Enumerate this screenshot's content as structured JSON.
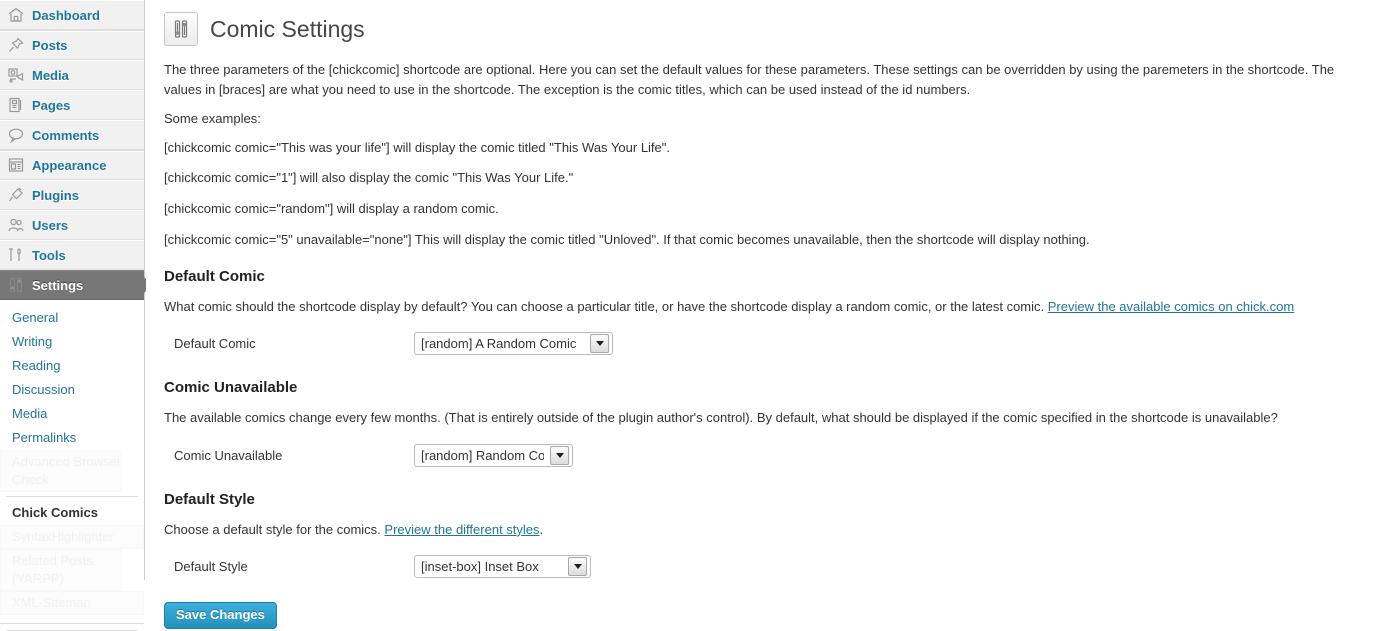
{
  "sidebar": {
    "top_items": [
      {
        "label": "Dashboard",
        "icon": "dashboard-home-icon",
        "current": false,
        "separator_before": false
      },
      {
        "label": "Posts",
        "icon": "pin-icon",
        "current": false,
        "separator_before": true
      },
      {
        "label": "Media",
        "icon": "media-camera-icon",
        "current": false,
        "separator_before": false
      },
      {
        "label": "Pages",
        "icon": "pages-icon",
        "current": false,
        "separator_before": false
      },
      {
        "label": "Comments",
        "icon": "comment-bubble-icon",
        "current": false,
        "separator_before": false
      },
      {
        "label": "Appearance",
        "icon": "appearance-layout-icon",
        "current": false,
        "separator_before": true
      },
      {
        "label": "Plugins",
        "icon": "plug-icon",
        "current": false,
        "separator_before": false
      },
      {
        "label": "Users",
        "icon": "users-icon",
        "current": false,
        "separator_before": false
      },
      {
        "label": "Tools",
        "icon": "tools-icon",
        "current": false,
        "separator_before": false
      },
      {
        "label": "Settings",
        "icon": "settings-sliders-icon",
        "current": true,
        "separator_before": false
      }
    ],
    "submenu": [
      {
        "label": "General",
        "state": "normal"
      },
      {
        "label": "Writing",
        "state": "normal"
      },
      {
        "label": "Reading",
        "state": "normal"
      },
      {
        "label": "Discussion",
        "state": "normal"
      },
      {
        "label": "Media",
        "state": "normal"
      },
      {
        "label": "Permalinks",
        "state": "normal"
      },
      {
        "label": "Advanced Browser Check",
        "state": "ghost"
      },
      {
        "label": "Chick Comics",
        "state": "current"
      },
      {
        "label": "SyntaxHighlighter",
        "state": "ghost"
      },
      {
        "label": "Related Posts (YARPP)",
        "state": "ghost"
      },
      {
        "label": "XML-Sitemap",
        "state": "ghost"
      }
    ]
  },
  "page": {
    "title": "Comic Settings",
    "icon": "settings-sliders-icon",
    "intro": "The three parameters of the [chickcomic] shortcode are optional. Here you can set the default values for these parameters. These settings can be overridden by using the paremeters in the shortcode. The values in [braces] are what you need to use in the shortcode. The exception is the comic titles, which can be used instead of the id numbers.",
    "examples_label": "Some examples:",
    "examples": [
      "[chickcomic comic=\"This was your life\"] will display the comic titled \"This Was Your Life\".",
      "[chickcomic comic=\"1\"] will also display the comic \"This Was Your Life.\"",
      "[chickcomic comic=\"random\"] will display a random comic.",
      "[chickcomic comic=\"5\" unavailable=\"none\"] This will display the comic titled \"Unloved\". If that comic becomes unavailable, then the shortcode will display nothing."
    ],
    "sections": [
      {
        "heading": "Default Comic",
        "description": "What comic should the shortcode display by default? You can choose a particular title, or have the shortcode display a random comic, or the latest comic.",
        "link_text": "Preview the available comics on chick.com",
        "description_tail": "",
        "field_label": "Default Comic",
        "field_value": "[random] A Random Comic"
      },
      {
        "heading": "Comic Unavailable",
        "description": "The available comics change every few months. (That is entirely outside of the plugin author's control). By default, what should be displayed if the comic specified in the shortcode is unavailable?",
        "link_text": "",
        "description_tail": "",
        "field_label": "Comic Unavailable",
        "field_value": "[random] Random Comic"
      },
      {
        "heading": "Default Style",
        "description": "Choose a default style for the comics.",
        "link_text": "Preview the different styles",
        "description_tail": ".",
        "field_label": "Default Style",
        "field_value": "[inset-box] Inset Box"
      }
    ],
    "save_label": "Save Changes"
  },
  "colors": {
    "link": "#21759b",
    "sidebar_bg": "#f1f1f1",
    "current_menu_bg": "#777777",
    "primary_button": "#2591bb",
    "text": "#333333"
  }
}
